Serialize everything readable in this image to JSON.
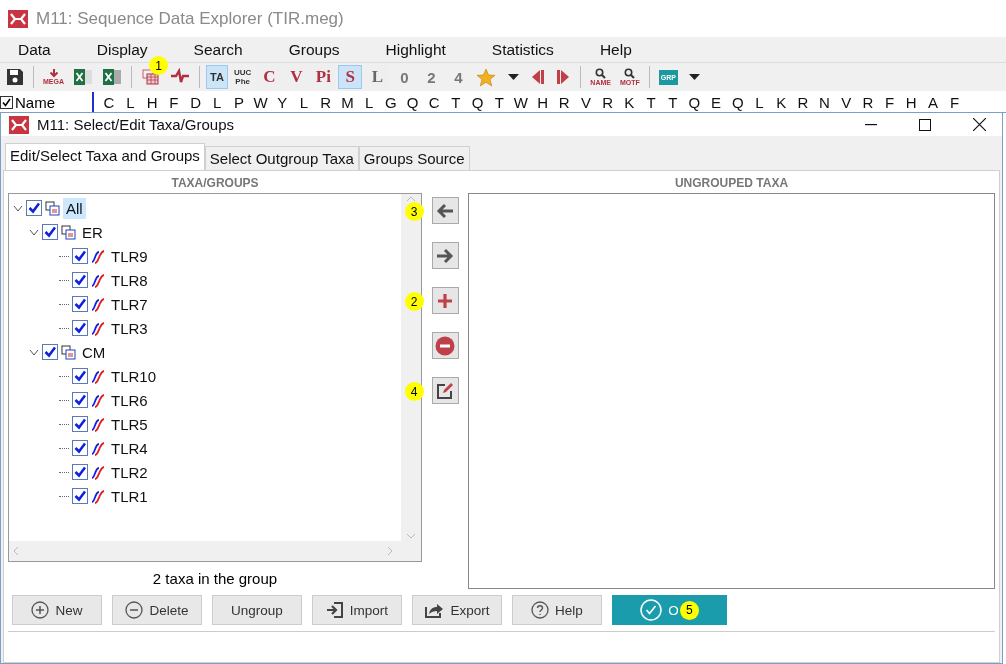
{
  "window": {
    "title": "M11: Sequence Data Explorer (TIR.meg)"
  },
  "menu": [
    "Data",
    "Display",
    "Search",
    "Groups",
    "Highlight",
    "Statistics",
    "Help"
  ],
  "toolbar": [
    {
      "kind": "save"
    },
    {
      "kind": "sep"
    },
    {
      "kind": "mega",
      "text": "MEGA"
    },
    {
      "kind": "excel"
    },
    {
      "kind": "excel-alt"
    },
    {
      "kind": "sep"
    },
    {
      "kind": "groups",
      "badge": "1"
    },
    {
      "kind": "flag"
    },
    {
      "kind": "sep"
    },
    {
      "kind": "tile",
      "text": "TA",
      "selected": true
    },
    {
      "kind": "codon",
      "text": "UUC",
      "sub": "Phe"
    },
    {
      "kind": "letter",
      "text": "C",
      "selected": false
    },
    {
      "kind": "letter",
      "text": "V",
      "selected": false
    },
    {
      "kind": "letter",
      "text": "Pi",
      "selected": false
    },
    {
      "kind": "letter",
      "text": "S",
      "selected": true
    },
    {
      "kind": "letter-muted",
      "text": "L",
      "selected": false
    },
    {
      "kind": "digit",
      "text": "0"
    },
    {
      "kind": "digit",
      "text": "2"
    },
    {
      "kind": "digit",
      "text": "4"
    },
    {
      "kind": "star"
    },
    {
      "kind": "caret"
    },
    {
      "kind": "prev"
    },
    {
      "kind": "next"
    },
    {
      "kind": "sep"
    },
    {
      "kind": "find",
      "text": "NAME"
    },
    {
      "kind": "find",
      "text": "MOTF"
    },
    {
      "kind": "sep"
    },
    {
      "kind": "grp",
      "text": "GRP"
    },
    {
      "kind": "caret"
    }
  ],
  "sequence_header": {
    "name_checked": true,
    "name": "Name",
    "letters": [
      "C",
      "L",
      "H",
      "F",
      "D",
      "L",
      "P",
      "W",
      "Y",
      "L",
      "R",
      "M",
      "L",
      "G",
      "Q",
      "C",
      "T",
      "Q",
      "T",
      "W",
      "H",
      "R",
      "V",
      "R",
      "K",
      "T",
      "T",
      "Q",
      "E",
      "Q",
      "L",
      "K",
      "R",
      "N",
      "V",
      "R",
      "F",
      "H",
      "A",
      "F"
    ]
  },
  "dialog": {
    "title": "M11: Select/Edit Taxa/Groups",
    "tabs": [
      {
        "label": "Edit/Select Taxa and Groups",
        "selected": true
      },
      {
        "label": "Select Outgroup Taxa",
        "selected": false
      },
      {
        "label": "Groups Source",
        "selected": false
      }
    ],
    "left_header": "TAXA/GROUPS",
    "tree": [
      {
        "label": "All",
        "kind": "group",
        "checked": true,
        "expanded": true,
        "selected": true,
        "children": [
          {
            "label": "ER",
            "kind": "group",
            "checked": true,
            "expanded": true,
            "selected": false,
            "children": [
              {
                "label": "TLR9",
                "kind": "taxon",
                "checked": true,
                "selected": false
              },
              {
                "label": "TLR8",
                "kind": "taxon",
                "checked": true,
                "selected": false
              },
              {
                "label": "TLR7",
                "kind": "taxon",
                "checked": true,
                "selected": false
              },
              {
                "label": "TLR3",
                "kind": "taxon",
                "checked": true,
                "selected": false
              }
            ]
          },
          {
            "label": "CM",
            "kind": "group",
            "checked": true,
            "expanded": true,
            "selected": false,
            "children": [
              {
                "label": "TLR10",
                "kind": "taxon",
                "checked": true,
                "selected": false
              },
              {
                "label": "TLR6",
                "kind": "taxon",
                "checked": true,
                "selected": false
              },
              {
                "label": "TLR5",
                "kind": "taxon",
                "checked": true,
                "selected": false
              },
              {
                "label": "TLR4",
                "kind": "taxon",
                "checked": true,
                "selected": false
              },
              {
                "label": "TLR2",
                "kind": "taxon",
                "checked": true,
                "selected": false
              },
              {
                "label": "TLR1",
                "kind": "taxon",
                "checked": true,
                "selected": false
              }
            ]
          }
        ]
      }
    ],
    "side_buttons": [
      {
        "kind": "left",
        "badge": "3"
      },
      {
        "kind": "right"
      },
      {
        "kind": "add",
        "badge": "2"
      },
      {
        "kind": "remove"
      },
      {
        "kind": "edit",
        "badge": "4"
      }
    ],
    "count_text": "2 taxa in the group",
    "right_header": "UNGROUPED TAXA",
    "buttons": [
      {
        "kind": "new",
        "label": "New"
      },
      {
        "kind": "delete",
        "label": "Delete"
      },
      {
        "kind": "plain",
        "label": "Ungroup"
      },
      {
        "kind": "import",
        "label": "Import"
      },
      {
        "kind": "export",
        "label": "Export"
      },
      {
        "kind": "help",
        "label": "Help"
      },
      {
        "kind": "ok",
        "label": "O",
        "badge": "5"
      }
    ]
  }
}
